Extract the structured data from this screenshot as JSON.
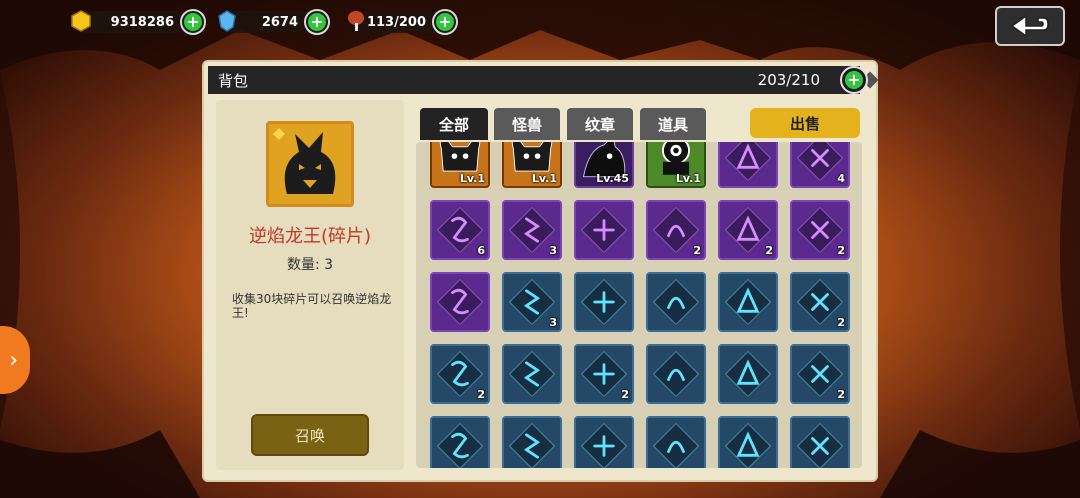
{
  "resources": {
    "gold": {
      "value": "9318286",
      "icon": "gold-icon"
    },
    "gems": {
      "value": "2674",
      "icon": "gem-icon"
    },
    "stamina": {
      "value": "113/200",
      "icon": "meat-icon"
    }
  },
  "panel": {
    "title": "背包",
    "capacity": "203/210"
  },
  "selected_item": {
    "name": "逆焰龙王(碎片)",
    "quantity": "数量: 3",
    "description": "收集30块碎片可以召唤逆焰龙王!",
    "action_label": "召唤"
  },
  "tabs": [
    {
      "label": "全部",
      "active": true
    },
    {
      "label": "怪兽",
      "active": false
    },
    {
      "label": "纹章",
      "active": false
    },
    {
      "label": "道具",
      "active": false
    }
  ],
  "sell_label": "出售",
  "grid_items": [
    {
      "style": "orange",
      "label": "Lv.1",
      "icon": "minotaur-icon"
    },
    {
      "style": "orange",
      "label": "Lv.1",
      "icon": "minotaur-icon"
    },
    {
      "style": "dpurple",
      "label": "Lv.45",
      "icon": "shadow-beast-icon"
    },
    {
      "style": "green",
      "label": "Lv.1",
      "icon": "eye-creature-icon"
    },
    {
      "style": "purple",
      "label": "",
      "icon": "rune-icon"
    },
    {
      "style": "purple",
      "label": "4",
      "icon": "rune-icon"
    },
    {
      "style": "purple",
      "label": "6",
      "icon": "rune-icon"
    },
    {
      "style": "purple",
      "label": "3",
      "icon": "rune-icon"
    },
    {
      "style": "purple",
      "label": "",
      "icon": "rune-icon"
    },
    {
      "style": "purple",
      "label": "2",
      "icon": "rune-icon"
    },
    {
      "style": "purple",
      "label": "2",
      "icon": "rune-icon"
    },
    {
      "style": "purple",
      "label": "2",
      "icon": "rune-icon"
    },
    {
      "style": "purple",
      "label": "",
      "icon": "rune-icon"
    },
    {
      "style": "blue",
      "label": "3",
      "icon": "rune-icon"
    },
    {
      "style": "blue",
      "label": "",
      "icon": "rune-icon"
    },
    {
      "style": "blue",
      "label": "",
      "icon": "rune-icon"
    },
    {
      "style": "blue",
      "label": "",
      "icon": "rune-icon"
    },
    {
      "style": "blue",
      "label": "2",
      "icon": "rune-icon"
    },
    {
      "style": "blue",
      "label": "2",
      "icon": "rune-icon"
    },
    {
      "style": "blue",
      "label": "",
      "icon": "rune-icon"
    },
    {
      "style": "blue",
      "label": "2",
      "icon": "rune-icon"
    },
    {
      "style": "blue",
      "label": "",
      "icon": "rune-icon"
    },
    {
      "style": "blue",
      "label": "",
      "icon": "rune-icon"
    },
    {
      "style": "blue",
      "label": "2",
      "icon": "rune-icon"
    },
    {
      "style": "blue",
      "label": "",
      "icon": "rune-icon"
    },
    {
      "style": "blue",
      "label": "",
      "icon": "rune-icon"
    },
    {
      "style": "blue",
      "label": "",
      "icon": "rune-icon"
    },
    {
      "style": "blue",
      "label": "",
      "icon": "rune-icon"
    },
    {
      "style": "blue",
      "label": "",
      "icon": "rune-icon"
    },
    {
      "style": "blue",
      "label": "",
      "icon": "rune-icon"
    }
  ],
  "colors": {
    "panel_bg": "#efe7cc",
    "gold_button": "#e4b21d",
    "summon_button": "#7a6214",
    "name_red": "#c0392b",
    "rune_glow_purple": "#d48cff",
    "rune_glow_blue": "#5fe3ff"
  }
}
